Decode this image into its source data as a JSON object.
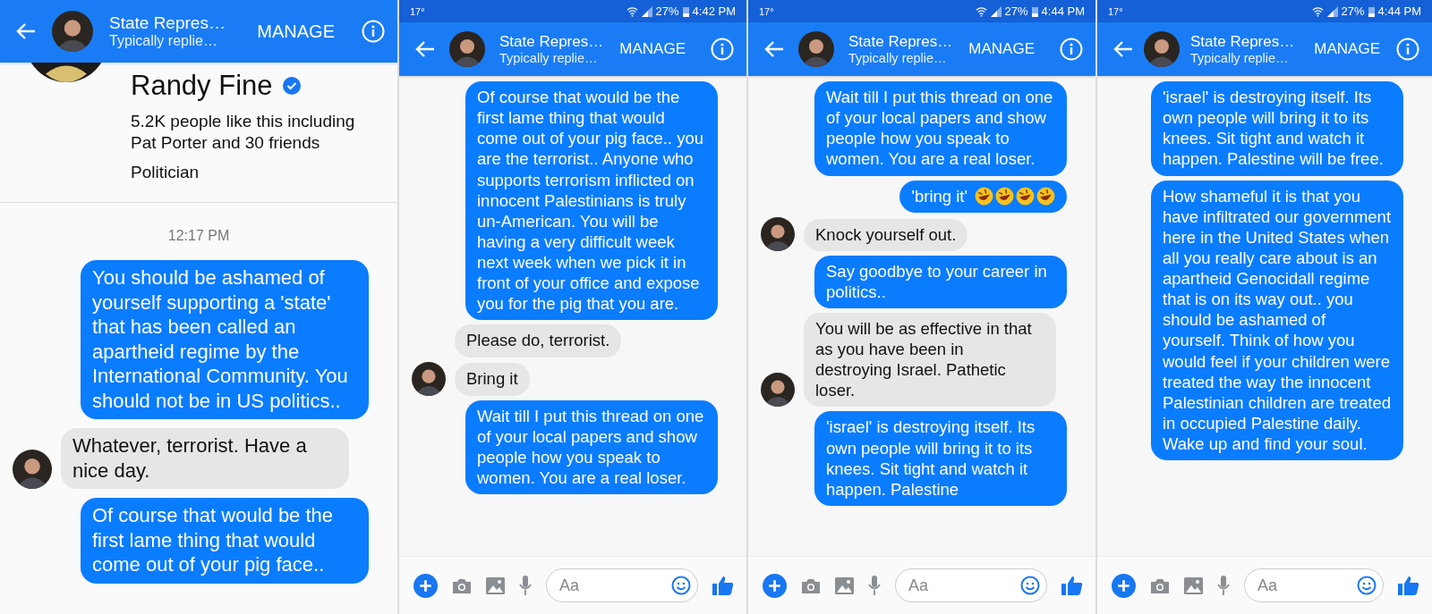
{
  "screens": [
    {
      "header": {
        "title": "State Repres…",
        "subtitle": "Typically replie…",
        "action": "MANAGE"
      },
      "profile": {
        "name": "Randy Fine",
        "verified": true,
        "likes": "5.2K people like this including Pat Porter and 30 friends",
        "category": "Politician"
      },
      "timestamp": "12:17 PM",
      "messages": [
        {
          "kind": "sent",
          "text": "You should be ashamed of yourself supporting a 'state' that has been called an apartheid regime by the International Community. You should not be in US politics.."
        },
        {
          "kind": "received",
          "show_avatar": true,
          "text": "Whatever, terrorist.  Have a nice day."
        },
        {
          "kind": "sent",
          "text": "Of course that would be the first lame thing that would come out of your pig face.."
        }
      ]
    },
    {
      "status_bar": {
        "temperature": "17°",
        "battery": "27%",
        "time": "4:42 PM"
      },
      "header": {
        "title": "State Repres…",
        "subtitle": "Typically replie…",
        "action": "MANAGE"
      },
      "messages": [
        {
          "kind": "sent",
          "text": "Of course that would be the first lame thing that would come out of your pig face.. you are the terrorist.. Anyone who supports terrorism inflicted on innocent Palestinians is truly un-American. You will be having a very difficult week next week when we pick it in front of your office and expose you for the pig that you are."
        },
        {
          "kind": "received",
          "show_avatar": false,
          "text": "Please do, terrorist."
        },
        {
          "kind": "received",
          "show_avatar": true,
          "text": "Bring it"
        },
        {
          "kind": "sent",
          "text": "Wait till I put this thread on one of your local papers and show people how you speak to women. You are a real loser."
        }
      ],
      "composer": {
        "placeholder": "Aa"
      }
    },
    {
      "status_bar": {
        "temperature": "17°",
        "battery": "27%",
        "time": "4:44 PM"
      },
      "header": {
        "title": "State Repres…",
        "subtitle": "Typically replie…",
        "action": "MANAGE"
      },
      "messages": [
        {
          "kind": "sent",
          "text": "Wait till I put this thread on one of your local papers and show people how you speak to women. You are a real loser."
        },
        {
          "kind": "sent",
          "text": "'bring it'",
          "emojis": [
            {
              "kind": "laughing"
            },
            {
              "kind": "laughing"
            },
            {
              "kind": "laughing"
            },
            {
              "kind": "laughing"
            }
          ]
        },
        {
          "kind": "received",
          "show_avatar": true,
          "text": "Knock yourself out."
        },
        {
          "kind": "sent",
          "text": "Say goodbye to your career in politics.."
        },
        {
          "kind": "received",
          "show_avatar": true,
          "text": "You will be as effective in that as you have been in destroying Israel.  Pathetic loser."
        },
        {
          "kind": "sent",
          "text": "'israel' is destroying itself. Its own people will bring it to its knees. Sit tight and watch it happen. Palestine"
        }
      ],
      "composer": {
        "placeholder": "Aa"
      }
    },
    {
      "status_bar": {
        "temperature": "17°",
        "battery": "27%",
        "time": "4:44 PM"
      },
      "header": {
        "title": "State Repres…",
        "subtitle": "Typically replie…",
        "action": "MANAGE"
      },
      "messages": [
        {
          "kind": "sent",
          "text": "'israel' is destroying itself. Its own people will bring it to its knees. Sit tight and watch it happen. Palestine will be free."
        },
        {
          "kind": "sent",
          "text": "How shameful it is that you have infiltrated our government here in the United States when all you really care about is an apartheid Genocidall regime that is on its way out.. you should be ashamed of yourself. Think of how you would feel if your children were treated the way the innocent Palestinian children are treated in occupied Palestine daily. Wake up and find your soul."
        }
      ],
      "composer": {
        "placeholder": "Aa"
      }
    }
  ]
}
